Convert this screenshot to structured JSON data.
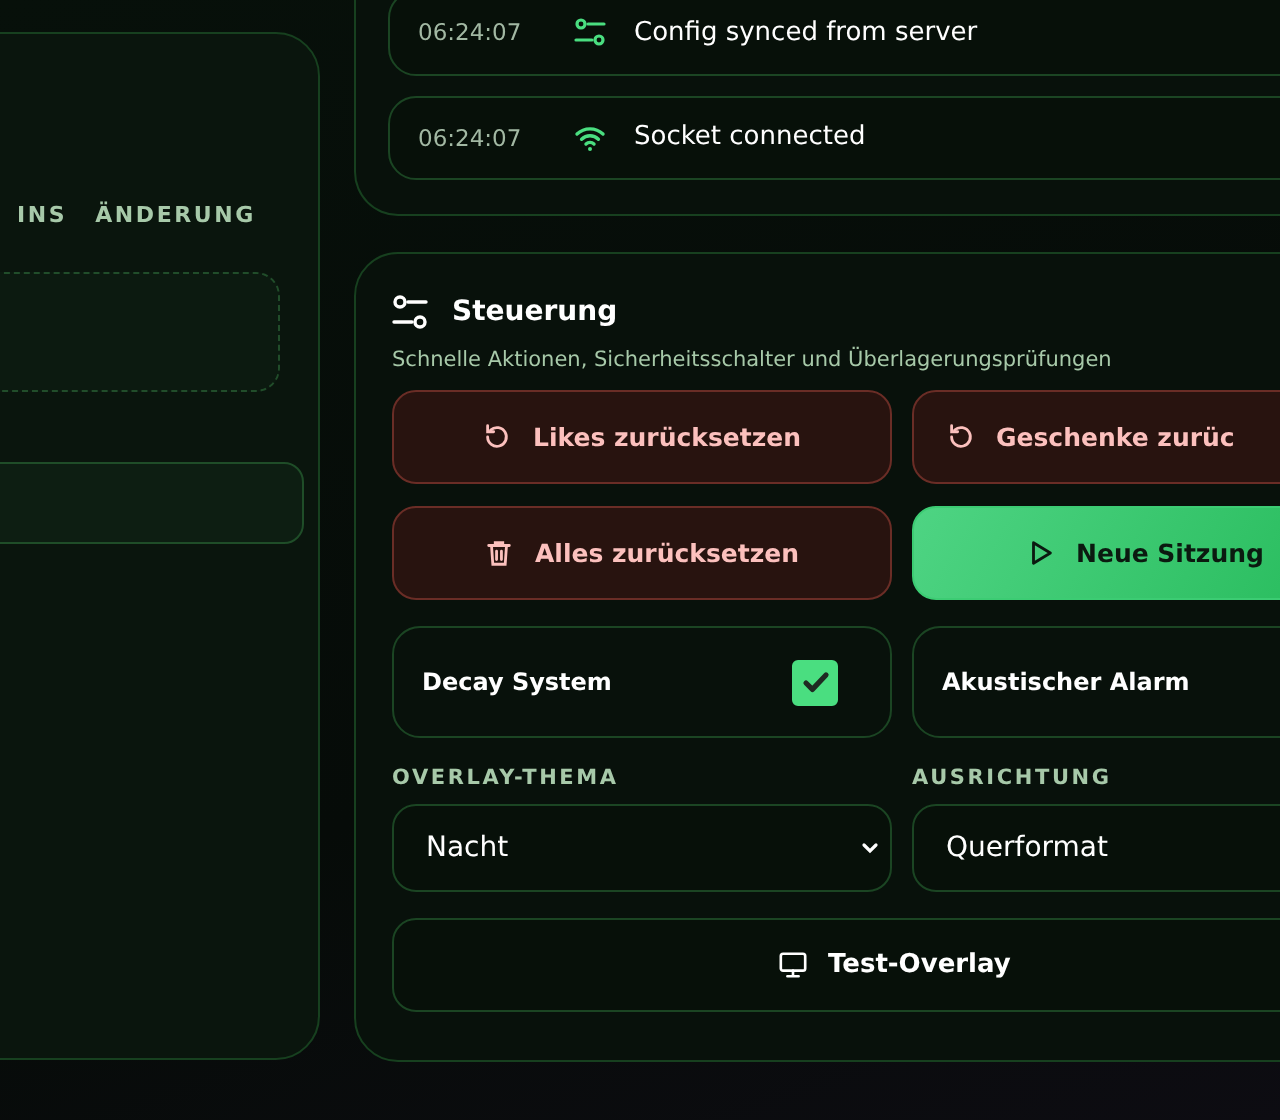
{
  "left_panel": {
    "columns": [
      "INS",
      "ÄNDERUNG"
    ]
  },
  "log": [
    {
      "time": "06:24:07",
      "message": "Config synced from server"
    },
    {
      "time": "06:24:07",
      "message": "Socket connected"
    }
  ],
  "controls": {
    "title": "Steuerung",
    "subtitle": "Schnelle Aktionen, Sicherheitsschalter und Überlagerungsprüfungen",
    "buttons": [
      {
        "label": "Likes zurücksetzen",
        "kind": "danger"
      },
      {
        "label": "Geschenke zurüc",
        "kind": "danger"
      },
      {
        "label": "Alles zurücksetzen",
        "kind": "danger"
      },
      {
        "label": "Neue Sitzung",
        "kind": "primary"
      }
    ],
    "toggles": [
      {
        "label": "Decay System",
        "checked": true
      },
      {
        "label": "Akustischer Alarm"
      }
    ],
    "selects": [
      {
        "label": "OVERLAY-THEMA",
        "value": "Nacht"
      },
      {
        "label": "AUSRICHTUNG",
        "value": "Querformat"
      }
    ],
    "test_button": "Test-Overlay"
  }
}
